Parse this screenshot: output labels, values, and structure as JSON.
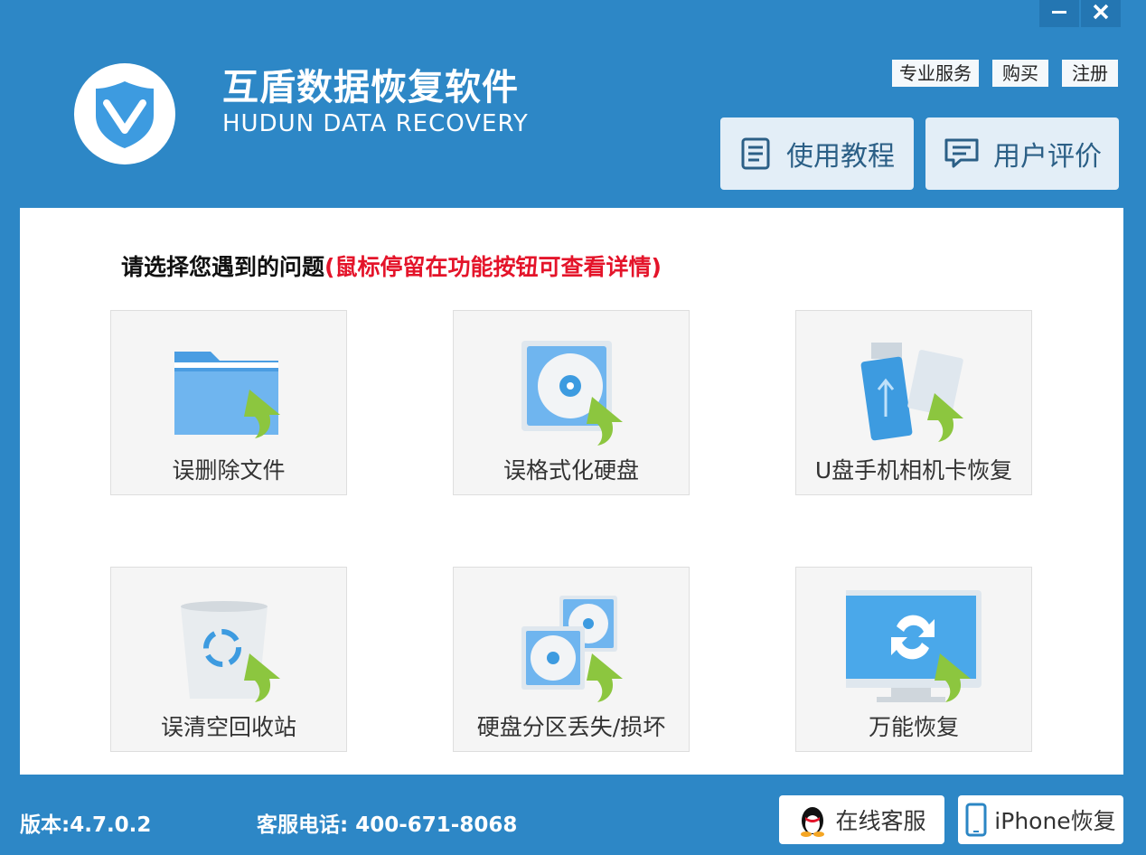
{
  "window": {
    "minimize_icon": "minimize-icon",
    "close_icon": "close-icon"
  },
  "header": {
    "title": "互盾数据恢复软件",
    "subtitle": "HUDUN DATA RECOVERY",
    "links": {
      "service": "专业服务",
      "buy": "购买",
      "register": "注册"
    },
    "buttons": {
      "tutorial": "使用教程",
      "reviews": "用户评价"
    }
  },
  "main": {
    "prompt": "请选择您遇到的问题",
    "prompt_hint": "(鼠标停留在功能按钮可查看详情)",
    "cards": [
      {
        "label": "误删除文件",
        "icon": "folder-restore-icon"
      },
      {
        "label": "误格式化硬盘",
        "icon": "disk-restore-icon"
      },
      {
        "label": "U盘手机相机卡恢复",
        "icon": "usb-card-restore-icon"
      },
      {
        "label": "误清空回收站",
        "icon": "recycle-bin-restore-icon"
      },
      {
        "label": "硬盘分区丢失/损坏",
        "icon": "partition-restore-icon"
      },
      {
        "label": "万能恢复",
        "icon": "monitor-restore-icon"
      }
    ]
  },
  "footer": {
    "version": "版本:4.7.0.2",
    "phone": "客服电话: 400-671-8068",
    "online_service": "在线客服",
    "iphone_recovery": "iPhone恢复"
  },
  "colors": {
    "chrome": "#2d87c6",
    "panel": "#ffffff",
    "hint": "#e4142a",
    "arrow": "#8cc63f",
    "icon_blue": "#3d9be0"
  }
}
